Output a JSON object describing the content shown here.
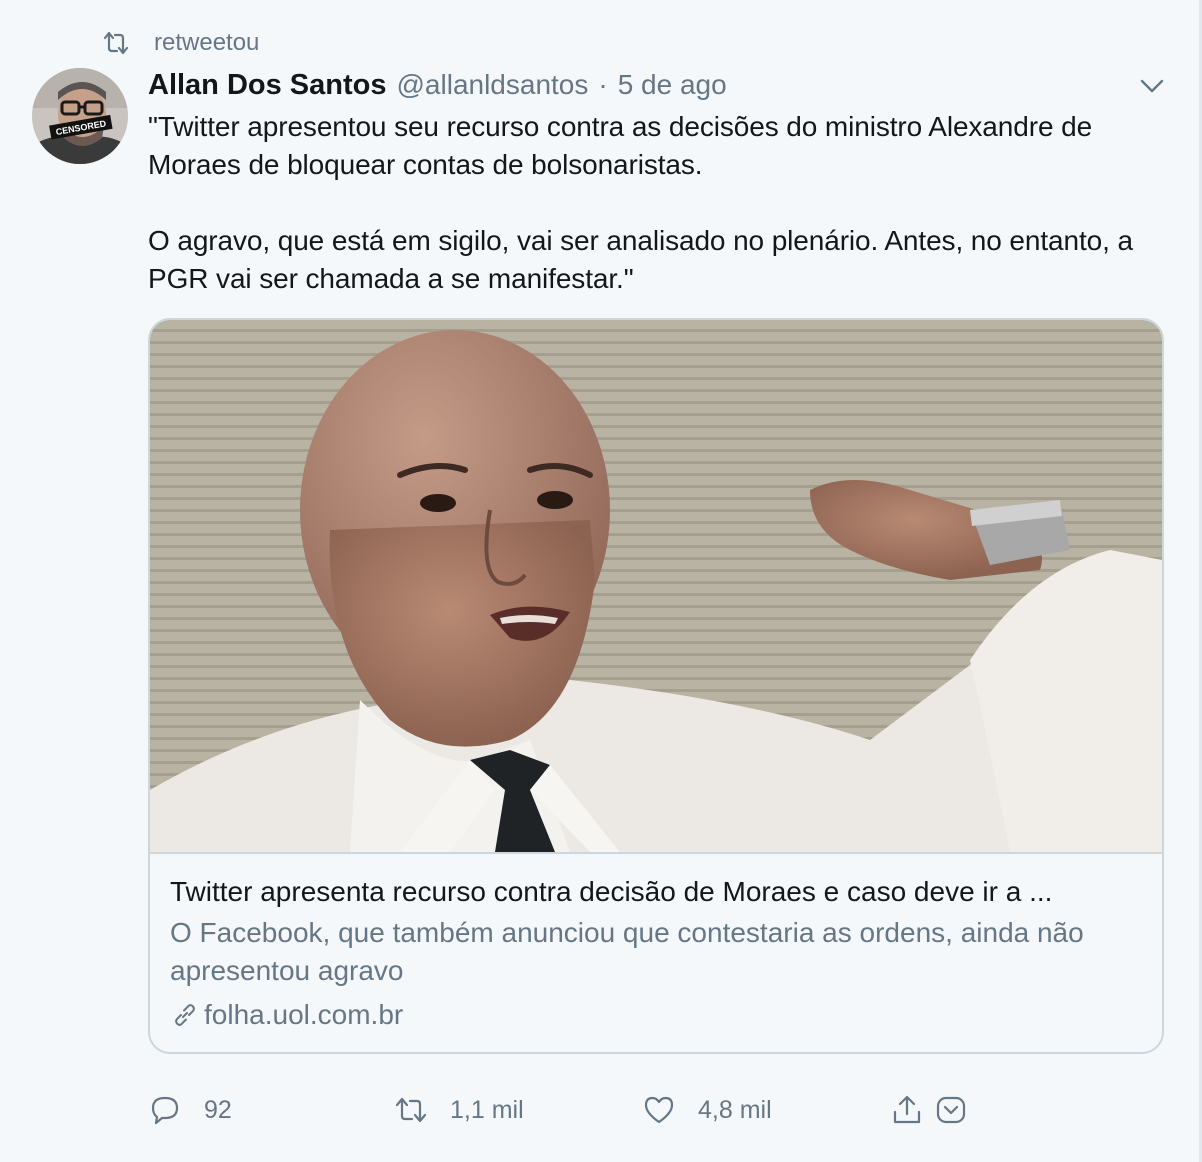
{
  "retweet_banner": {
    "icon": "retweet-icon",
    "text": "retweetou"
  },
  "author": {
    "display_name": "Allan Dos Santos",
    "handle": "@allanldsantos",
    "separator": "·",
    "timestamp": "5 de ago",
    "avatar_badge_text": "CENSORED"
  },
  "tweet": {
    "paragraphs": [
      "\"Twitter apresentou seu recurso contra as decisões do ministro Alexandre de Moraes de bloquear contas de bolsonaristas.",
      "O agravo, que está em sigilo, vai ser analisado no plenário. Antes, no entanto, a PGR vai ser chamada a se manifestar.\""
    ]
  },
  "card": {
    "title": "Twitter apresenta recurso contra decisão de Moraes e caso deve ir a ...",
    "description": "O Facebook, que também anunciou que contestaria as ordens, ainda não apresentou agravo",
    "domain": "folha.uol.com.br",
    "link_icon": "link-icon"
  },
  "actions": {
    "reply_count": "92",
    "retweet_count": "1,1 mil",
    "like_count": "4,8 mil"
  },
  "colors": {
    "background": "#f5f8fa",
    "text_primary": "#14171a",
    "text_secondary": "#657786",
    "border": "#ccd6dd"
  }
}
